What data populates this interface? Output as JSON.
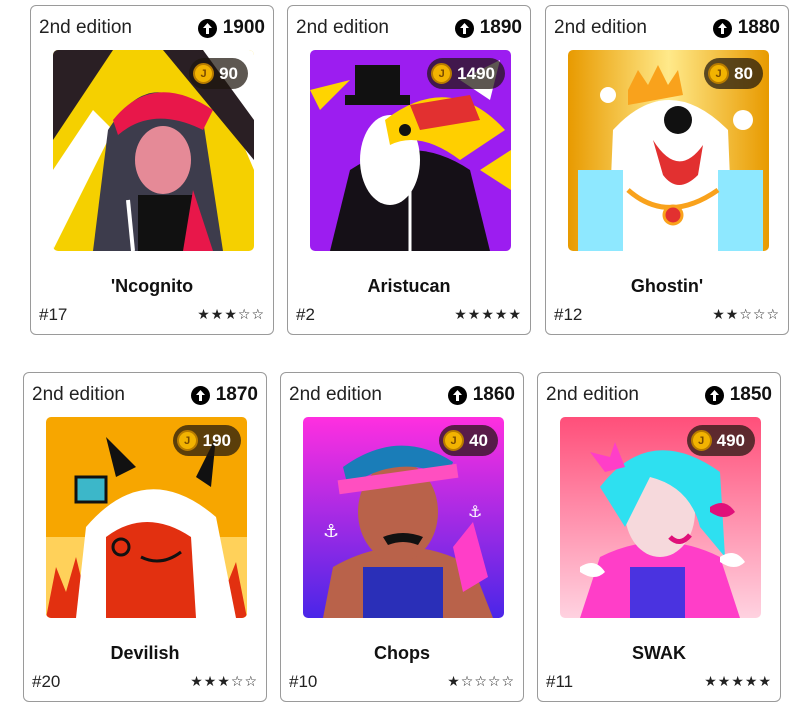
{
  "cards": [
    {
      "edition": "2nd edition",
      "score": "1900",
      "price": "90",
      "name": "'Ncognito",
      "rank": "#17",
      "stars": "★★★☆☆",
      "colors": {
        "bg": "#f5d000",
        "accent": "#e8174a"
      }
    },
    {
      "edition": "2nd edition",
      "score": "1890",
      "price": "1490",
      "name": "Aristucan",
      "rank": "#2",
      "stars": "★★★★★",
      "colors": {
        "bg": "#9c1df0",
        "accent": "#ffd400"
      }
    },
    {
      "edition": "2nd edition",
      "score": "1880",
      "price": "80",
      "name": "Ghostin'",
      "rank": "#12",
      "stars": "★★☆☆☆",
      "colors": {
        "bg": "#f6c21a",
        "accent": "#ffffff"
      }
    },
    {
      "edition": "2nd edition",
      "score": "1870",
      "price": "190",
      "name": "Devilish",
      "rank": "#20",
      "stars": "★★★☆☆",
      "colors": {
        "bg": "#f7a600",
        "accent": "#e23010"
      }
    },
    {
      "edition": "2nd edition",
      "score": "1860",
      "price": "40",
      "name": "Chops",
      "rank": "#10",
      "stars": "★☆☆☆☆",
      "colors": {
        "bg": "#7a2cf0",
        "accent": "#ff3ec8"
      }
    },
    {
      "edition": "2nd edition",
      "score": "1850",
      "price": "490",
      "name": "SWAK",
      "rank": "#11",
      "stars": "★★★★★",
      "colors": {
        "bg": "#ff6fa0",
        "accent": "#2ee0f0"
      }
    }
  ],
  "icons": {
    "score": "arrow-up-circle-icon",
    "price": "coin-icon"
  }
}
